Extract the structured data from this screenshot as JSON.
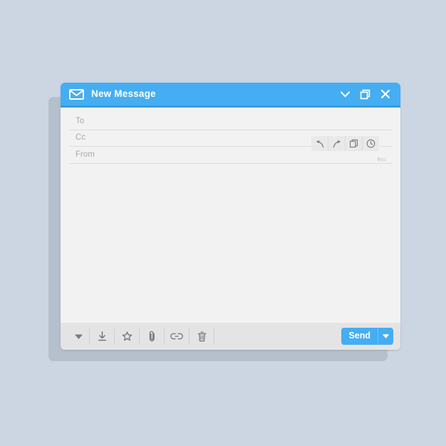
{
  "window": {
    "title": "New Message",
    "icon": "envelope-icon",
    "accent_color": "#45adf2",
    "accent_dark": "#3a9ada",
    "body_color": "#f2f2f2",
    "bottom_bar_color": "#e4e4e4",
    "background_color": "#ccd5e2",
    "shadow_color": "#b6bfcc",
    "controls": [
      {
        "name": "minimize-button",
        "icon": "chevron-down-icon"
      },
      {
        "name": "restore-button",
        "icon": "restore-window-icon"
      },
      {
        "name": "close-button",
        "icon": "close-icon"
      }
    ]
  },
  "fields": [
    {
      "name": "to-field",
      "label": "To",
      "value": "",
      "placeholder": "To"
    },
    {
      "name": "cc-field",
      "label": "Cc",
      "value": "",
      "placeholder": "Cc"
    },
    {
      "name": "from-field",
      "label": "From",
      "value": "",
      "placeholder": "From"
    }
  ],
  "bcc_label": "Bcc",
  "edit_toolbar": [
    {
      "name": "undo-button",
      "icon": "undo-arrow-icon"
    },
    {
      "name": "redo-button",
      "icon": "redo-arrow-icon"
    },
    {
      "name": "copy-button",
      "icon": "copy-pages-icon"
    },
    {
      "name": "info-button",
      "icon": "info-circle-icon"
    }
  ],
  "body": {
    "value": "",
    "placeholder": ""
  },
  "bottom_toolbar": [
    {
      "name": "formatting-dropdown-button",
      "icon": "triangle-down-icon"
    },
    {
      "name": "save-draft-button",
      "icon": "download-icon"
    },
    {
      "name": "favorite-button",
      "icon": "star-icon"
    },
    {
      "name": "attach-button",
      "icon": "paperclip-icon"
    },
    {
      "name": "insert-link-button",
      "icon": "link-icon"
    },
    {
      "name": "delete-button",
      "icon": "trash-icon"
    }
  ],
  "send": {
    "label": "Send",
    "dropdown_icon": "triangle-down-icon",
    "color": "#45adf2"
  }
}
